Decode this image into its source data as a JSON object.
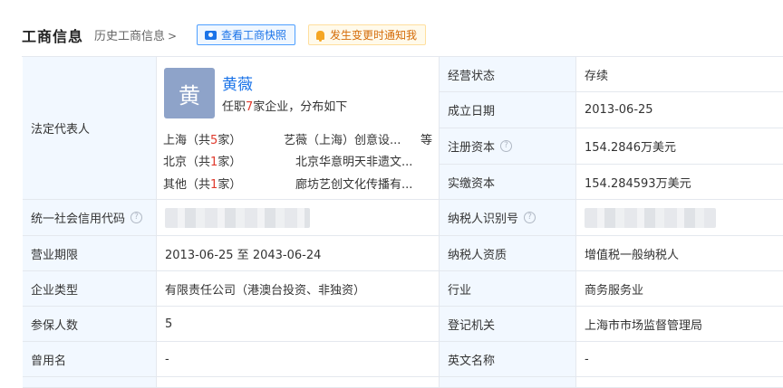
{
  "header": {
    "title": "工商信息",
    "history_link": "历史工商信息",
    "snapshot_button": "查看工商快照",
    "notify_button": "发生变更时通知我"
  },
  "legal_rep": {
    "label": "法定代表人",
    "avatar_char": "黄",
    "name": "黄薇",
    "summary_prefix": "任职",
    "summary_count": "7",
    "summary_suffix": "家企业，分布如下",
    "locations": [
      {
        "region": "上海",
        "open": "（共",
        "count": "5",
        "close": "家）",
        "company": "艺薇（上海）创意设...",
        "more": "等"
      },
      {
        "region": "北京",
        "open": "（共",
        "count": "1",
        "close": "家）",
        "company": "北京华意明天非遗文..."
      },
      {
        "region": "其他",
        "open": "（共",
        "count": "1",
        "close": "家）",
        "company": "廊坊艺创文化传播有..."
      }
    ]
  },
  "rows_right_top": [
    {
      "label": "经营状态",
      "value": "存续"
    },
    {
      "label": "成立日期",
      "value": "2013-06-25"
    },
    {
      "label": "注册资本",
      "value": "154.2846万美元",
      "help": "?"
    },
    {
      "label": "实缴资本",
      "value": "154.284593万美元"
    }
  ],
  "credit_code": {
    "label": "统一社会信用代码",
    "help": "?"
  },
  "taxpayer_id": {
    "label": "纳税人识别号",
    "help": "?"
  },
  "rows": [
    {
      "label": "营业期限",
      "value": "2013-06-25 至 2043-06-24",
      "label2": "纳税人资质",
      "value2": "增值税一般纳税人"
    },
    {
      "label": "企业类型",
      "value": "有限责任公司（港澳台投资、非独资）",
      "label2": "行业",
      "value2": "商务服务业"
    },
    {
      "label": "参保人数",
      "value": "5",
      "label2": "登记机关",
      "value2": "上海市市场监督管理局"
    },
    {
      "label": "曾用名",
      "value": "-",
      "label2": "英文名称",
      "value2": "-"
    }
  ]
}
